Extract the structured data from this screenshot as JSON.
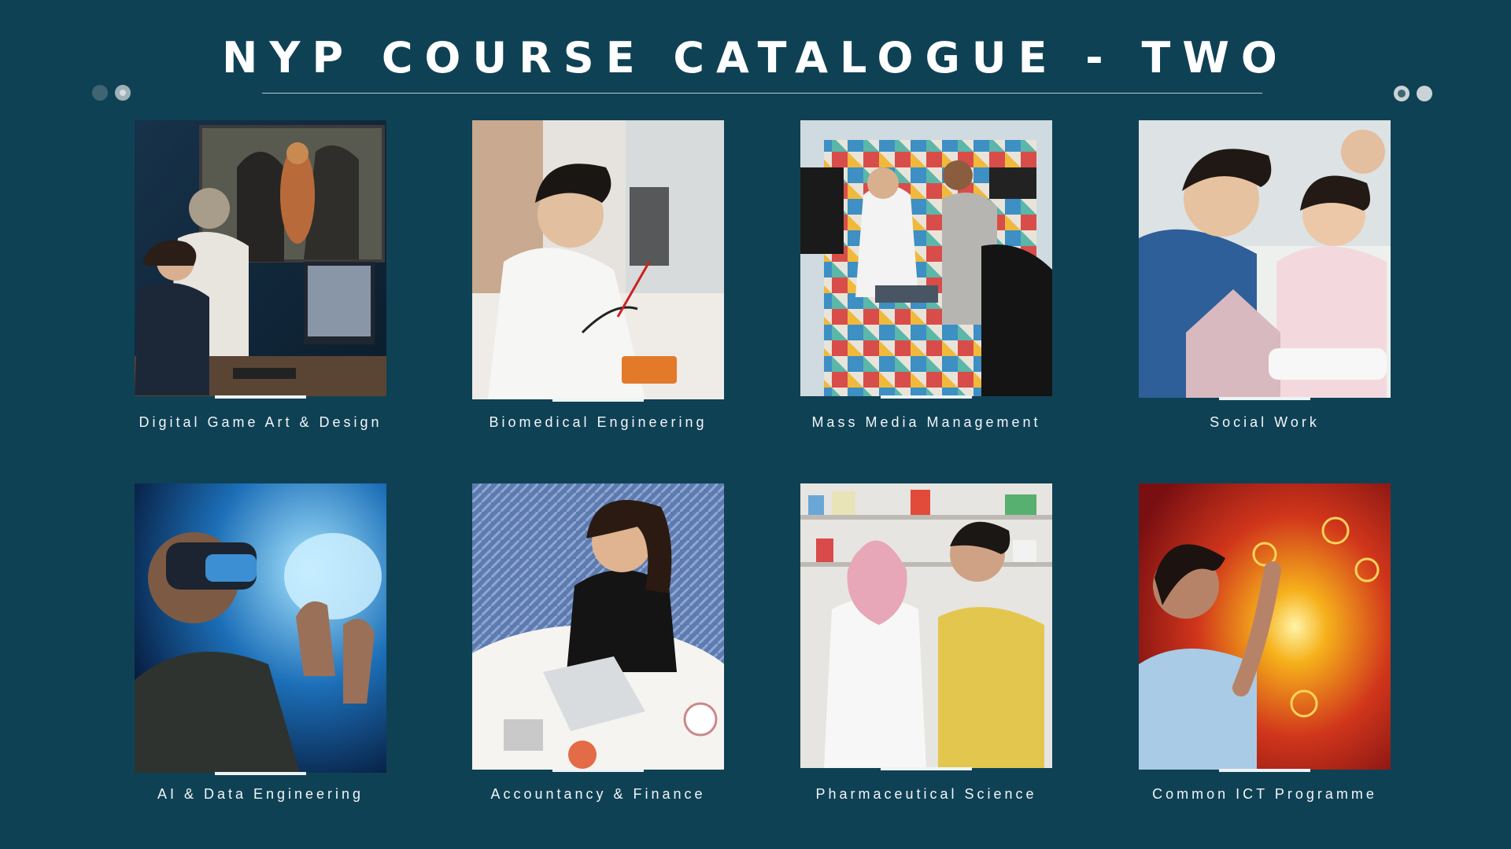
{
  "page": {
    "title": "NYP COURSE CATALOGUE - TWO",
    "background_color": "#0f4155"
  },
  "courses": [
    {
      "label": "Digital Game Art & Design",
      "image": "students-designing-game-character-photo"
    },
    {
      "label": "Biomedical Engineering",
      "image": "student-testing-circuit-in-lab-photo"
    },
    {
      "label": "Mass Media Management",
      "image": "tv-studio-interview-photo"
    },
    {
      "label": "Social Work",
      "image": "counsellor-playing-with-children-photo"
    },
    {
      "label": "AI & Data Engineering",
      "image": "student-with-vr-headset-and-hologram-brain-photo"
    },
    {
      "label": "Accountancy & Finance",
      "image": "student-working-on-laptop-with-reports-photo"
    },
    {
      "label": "Pharmaceutical Science",
      "image": "pharmacist-advising-customer-photo"
    },
    {
      "label": "Common ICT Programme",
      "image": "student-touching-holographic-interface-photo"
    }
  ]
}
